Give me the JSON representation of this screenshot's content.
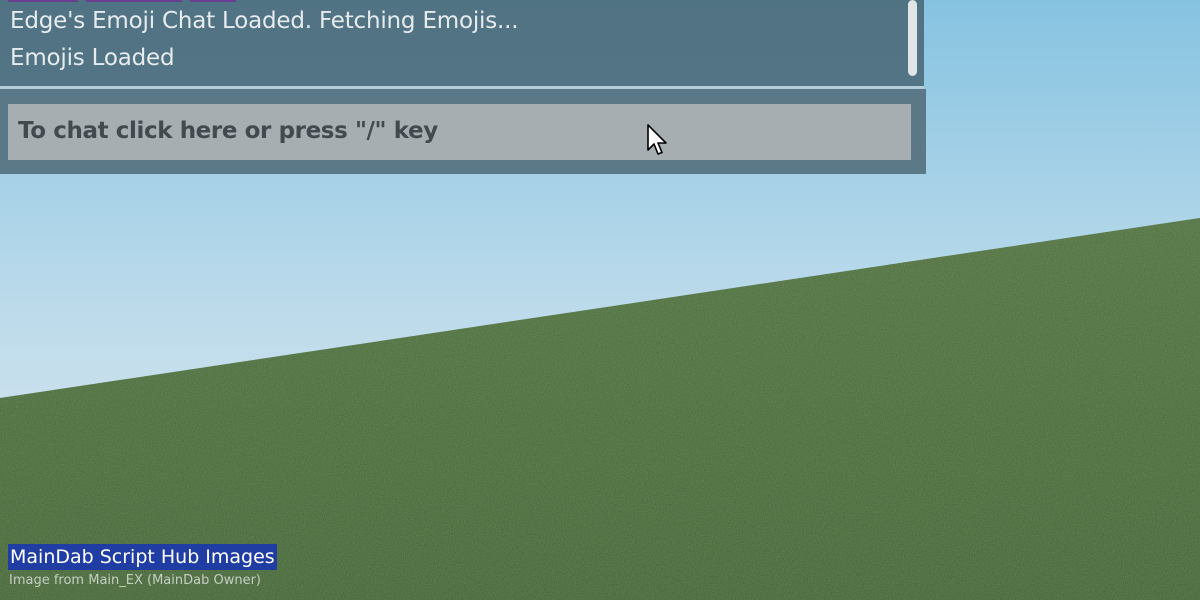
{
  "chat": {
    "messages": [
      "Edge's Emoji Chat Loaded. Fetching Emojis...",
      "Emojis Loaded"
    ],
    "input_placeholder": "To chat click here or press \"/\" key"
  },
  "watermark": {
    "title": "MainDab Script Hub Images",
    "credit": "Image from Main_EX (MainDab Owner)"
  },
  "colors": {
    "sky_top": "#8cc6e2",
    "sky_horizon": "#dfe8ee",
    "grass": "#48673a",
    "chat_panel": "#496876",
    "chat_input": "#a7aeb2",
    "watermark_highlight": "#1f3da2",
    "partial_name_color": "#6a3e8f"
  },
  "icons": {
    "cursor": "mouse-pointer-icon"
  }
}
